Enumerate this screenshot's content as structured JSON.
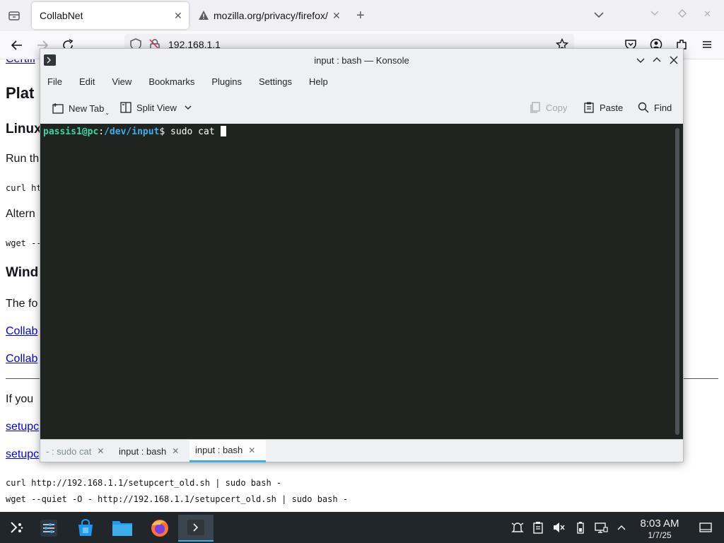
{
  "firefox": {
    "tabs": [
      {
        "label": "CollabNet",
        "active": true
      },
      {
        "label": "mozilla.org/privacy/firefox/",
        "active": false
      }
    ],
    "url": "192.168.1.1",
    "page": {
      "cert_link": "Certifi",
      "heading_platform": "Plat",
      "heading_linux": "Linux",
      "run_text": "Run th",
      "curl_partial": "curl ht",
      "alt_text": "Altern",
      "wget_partial": "wget --",
      "heading_windows": "Wind",
      "follow_text": "The fo",
      "collab_link_1": "Collab",
      "collab_link_2": "Collab",
      "if_text": "If you",
      "setup_link_1": "setupc",
      "setup_link_2": "setupc",
      "curl_full": "curl http://192.168.1.1/setupcert_old.sh | sudo bash -",
      "wget_full": "wget --quiet -O - http://192.168.1.1/setupcert_old.sh | sudo bash -"
    }
  },
  "konsole": {
    "title": "input : bash — Konsole",
    "menu": [
      "File",
      "Edit",
      "View",
      "Bookmarks",
      "Plugins",
      "Settings",
      "Help"
    ],
    "toolbar": {
      "new_tab": "New Tab",
      "split_view": "Split View",
      "copy": "Copy",
      "paste": "Paste",
      "find": "Find"
    },
    "terminal": {
      "user_host": "passis1@pc",
      "separator": ":",
      "path": "/dev/input",
      "prompt_end": "$ ",
      "command": "sudo cat "
    },
    "tabs": [
      {
        "label": "- : sudo cat",
        "state": "dim"
      },
      {
        "label": "input : bash",
        "state": "normal"
      },
      {
        "label": "input : bash",
        "state": "active"
      }
    ]
  },
  "taskbar": {
    "time": "8:03 AM",
    "date": "1/7/25"
  },
  "colors": {
    "accent": "#3daee9",
    "terminal_bg": "#1f2420",
    "prompt_user": "#3bd6a4",
    "link": "#0000ee"
  }
}
